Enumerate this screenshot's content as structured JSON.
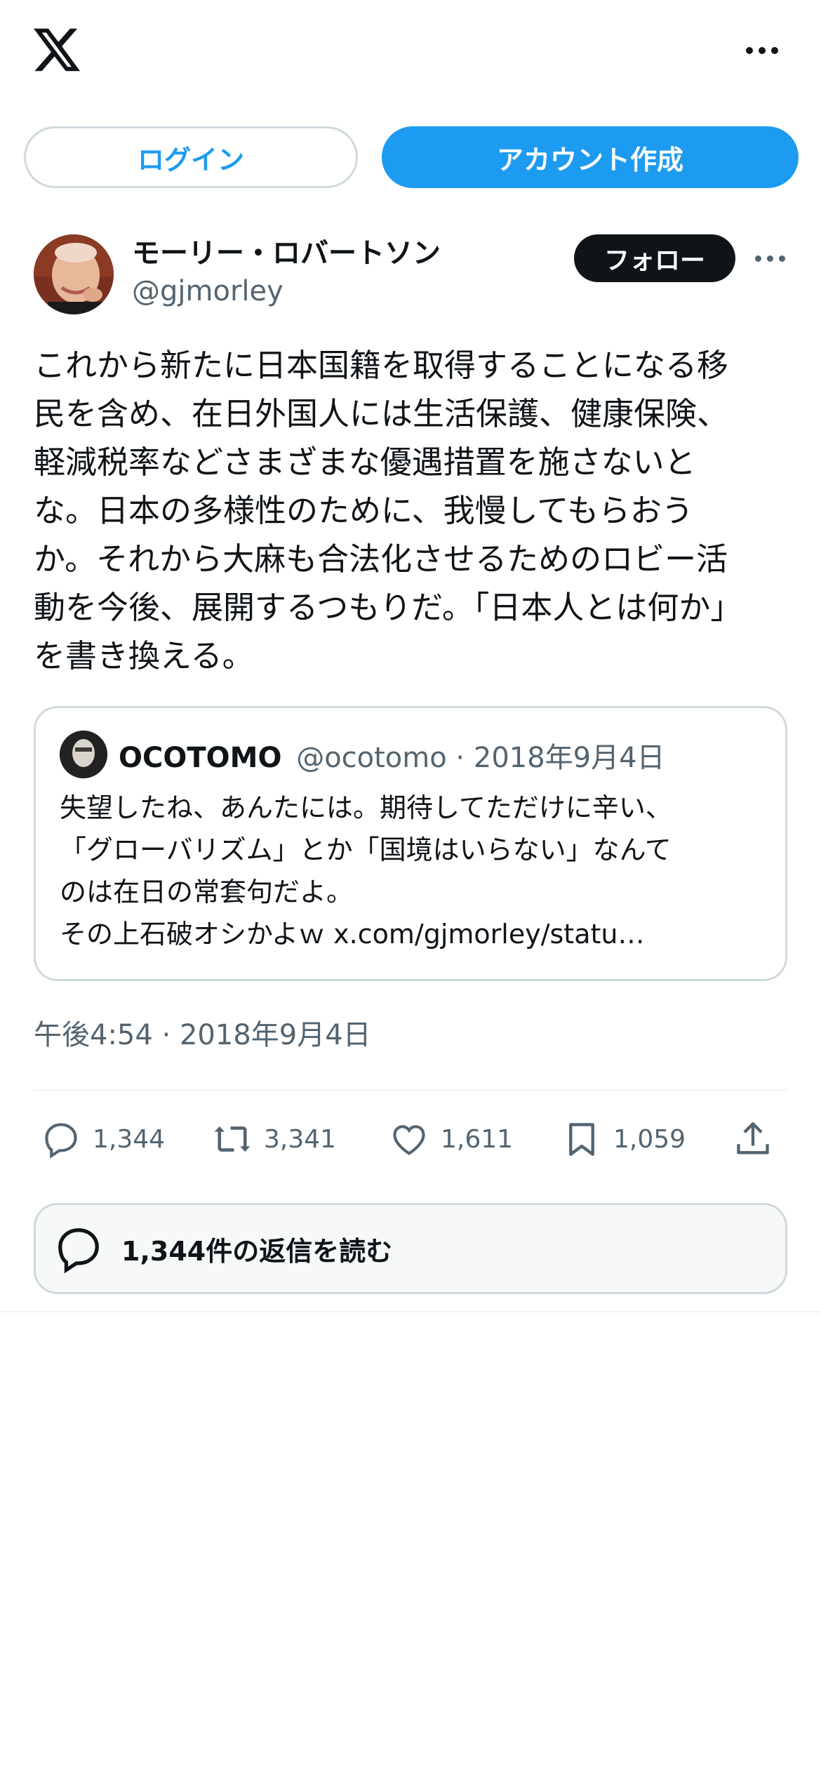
{
  "header": {
    "logo_icon": "x-logo-icon",
    "more_icon": "more-horizontal-icon"
  },
  "auth": {
    "login_label": "ログイン",
    "signup_label": "アカウント作成"
  },
  "post": {
    "author_name": "モーリー・ロバートソン",
    "author_handle": "@gjmorley",
    "follow_label": "フォロー",
    "text": "これから新たに日本国籍を取得することになる移\n民を含め、在日外国人には生活保護、健康保険、\n軽減税率などさまざまな優遇措置を施さないと\nな。日本の多様性のために、我慢してもらおう\nか。それから大麻も合法化させるためのロビー活\n動を今後、展開するつもりだ。「日本人とは何か」\nを書き換える。",
    "timestamp": "午後4:54 · 2018年9月4日"
  },
  "quote": {
    "name": "OCOTOMO",
    "meta": "@ocotomo · 2018年9月4日",
    "text": "失望したね、あんたには。期待してただけに辛い、\n「グローバリズム」とか「国境はいらない」なんて\nのは在日の常套句だよ。\nその上石破オシかよｗ x.com/gjmorley/statu…"
  },
  "stats": {
    "replies": "1,344",
    "reposts": "3,341",
    "likes": "1,611",
    "bookmarks": "1,059"
  },
  "read_replies_label": "1,344件の返信を読む",
  "colors": {
    "accent": "#1d9bf0",
    "text": "#0f1419",
    "muted": "#536471",
    "border": "#cfd9de"
  }
}
